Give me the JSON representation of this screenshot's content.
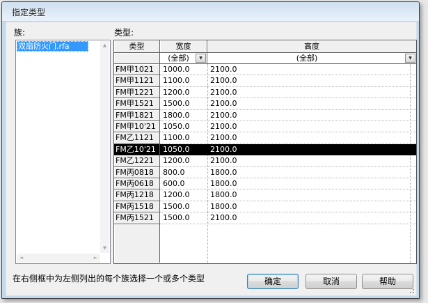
{
  "window": {
    "title": "指定类型"
  },
  "panel": {
    "family_label": "族:",
    "type_label": "类型:",
    "families": [
      {
        "name": "双扇防火门.rfa",
        "selected": true
      }
    ],
    "hint": "在右侧框中为左侧列出的每个族选择一个或多个类型"
  },
  "buttons": {
    "ok": "确定",
    "cancel": "取消",
    "help": "帮助"
  },
  "table": {
    "columns": [
      "类型",
      "宽度",
      "高度"
    ],
    "filter_placeholder": "(全部)",
    "rows": [
      {
        "type": "FM甲1021",
        "width": "1000.0",
        "height": "2100.0",
        "selected": false
      },
      {
        "type": "FM甲1121",
        "width": "1100.0",
        "height": "2100.0",
        "selected": false
      },
      {
        "type": "FM甲1221",
        "width": "1200.0",
        "height": "2100.0",
        "selected": false
      },
      {
        "type": "FM甲1521",
        "width": "1500.0",
        "height": "2100.0",
        "selected": false
      },
      {
        "type": "FM甲1821",
        "width": "1800.0",
        "height": "2100.0",
        "selected": false
      },
      {
        "type": "FM甲10'21",
        "width": "1050.0",
        "height": "2100.0",
        "selected": false
      },
      {
        "type": "FM乙1121",
        "width": "1100.0",
        "height": "2100.0",
        "selected": false
      },
      {
        "type": "FM乙10'21",
        "width": "1050.0",
        "height": "2100.0",
        "selected": true
      },
      {
        "type": "FM乙1221",
        "width": "1200.0",
        "height": "2100.0",
        "selected": false
      },
      {
        "type": "FM丙0818",
        "width": "800.0",
        "height": "1800.0",
        "selected": false
      },
      {
        "type": "FM丙0618",
        "width": "600.0",
        "height": "1800.0",
        "selected": false
      },
      {
        "type": "FM丙1218",
        "width": "1200.0",
        "height": "1800.0",
        "selected": false
      },
      {
        "type": "FM丙1518",
        "width": "1500.0",
        "height": "1800.0",
        "selected": false
      },
      {
        "type": "FM丙1521",
        "width": "1500.0",
        "height": "2100.0",
        "selected": false
      }
    ]
  },
  "icons": {
    "dropdown": "▼",
    "scroll_up": "▲",
    "scroll_down": "▼",
    "scroll_left": "◄",
    "scroll_right": "►"
  },
  "colors": {
    "selection-blue": "#3399ff",
    "selected-row-bg": "#000000",
    "selected-row-text": "#ffffff",
    "titlebar-top": "#cfdfef",
    "titlebar-bottom": "#e9f2fb",
    "frame": "#c3d9ec",
    "content-bg": "#f0f0f0",
    "accent-focus": "#3c7fb1"
  }
}
